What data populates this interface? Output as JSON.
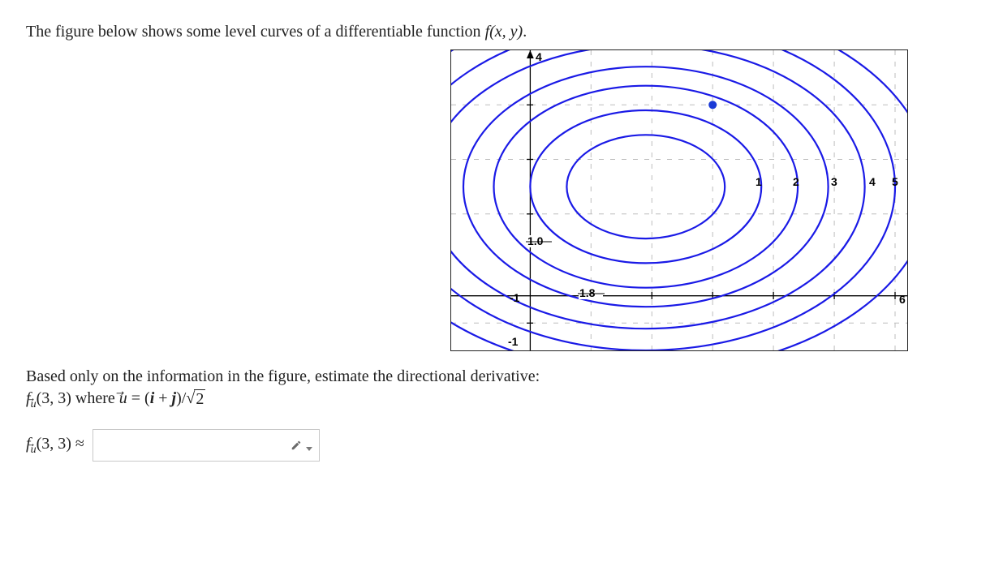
{
  "intro_prefix": "The figure below shows some level curves of a differentiable function ",
  "intro_func": "f(x, y)",
  "intro_suffix": ".",
  "axis": {
    "x_ticks": [
      "1",
      "2",
      "3",
      "4",
      "5",
      "6"
    ],
    "y_ticks_top": "4",
    "y_tick_neg1": "-1",
    "contour_label_upper": "1.0",
    "contour_label_lower": "1.8",
    "x_origin_label": "-1"
  },
  "prompt_line": "Based only on the information in the figure, estimate the directional derivative:",
  "deriv_expr": {
    "f": "f",
    "sub_u": "u",
    "point": "(3, 3)",
    "where": " where ",
    "u": "u",
    "eq": " = (",
    "i": "i",
    "plus": " + ",
    "j": "j",
    "close": ")/",
    "root": "2"
  },
  "answer": {
    "label_f": "f",
    "label_sub": "u",
    "label_point": "(3, 3) ≈",
    "placeholder": ""
  },
  "chart_data": {
    "type": "contour",
    "title": "",
    "x_range": [
      -1.3,
      6.2
    ],
    "y_range": [
      -1.5,
      4.0
    ],
    "x_ticks": [
      1,
      2,
      3,
      4,
      5,
      6
    ],
    "y_ticks": [
      -1,
      1,
      2,
      3,
      4
    ],
    "contour_center_estimate": [
      1.9,
      1.5
    ],
    "contours": [
      {
        "label": "1.0",
        "approx_level": 1.0,
        "semi_axes_estimate": [
          1.3,
          0.95
        ]
      },
      {
        "label": null,
        "approx_level": 1.2,
        "semi_axes_estimate": [
          1.9,
          1.4
        ]
      },
      {
        "label": null,
        "approx_level": 1.4,
        "semi_axes_estimate": [
          2.5,
          1.85
        ]
      },
      {
        "label": null,
        "approx_level": 1.6,
        "semi_axes_estimate": [
          3.0,
          2.2
        ]
      },
      {
        "label": "1.8",
        "approx_level": 1.8,
        "semi_axes_estimate": [
          3.6,
          2.6
        ]
      },
      {
        "label": null,
        "approx_level": 2.0,
        "semi_axes_estimate": [
          4.1,
          3.0
        ]
      },
      {
        "label": null,
        "approx_level": 2.2,
        "semi_axes_estimate": [
          4.7,
          3.4
        ]
      }
    ],
    "marked_point": [
      3,
      3
    ]
  }
}
